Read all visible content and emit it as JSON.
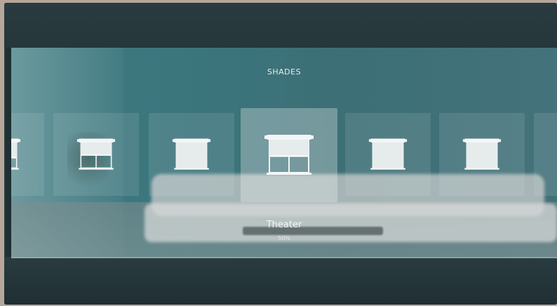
{
  "screen": {
    "title": "SHADES",
    "selected": {
      "label": "Theater",
      "level": "50%"
    }
  },
  "shades": [
    {
      "id": 1,
      "level_fraction": 0.4,
      "selected": false
    },
    {
      "id": 2,
      "level_fraction": 0.5,
      "selected": false
    },
    {
      "id": 3,
      "level_fraction": 0.0,
      "selected": false
    },
    {
      "id": 4,
      "level_fraction": 0.5,
      "selected": true
    },
    {
      "id": 5,
      "level_fraction": 0.0,
      "selected": false
    },
    {
      "id": 6,
      "level_fraction": 0.0,
      "selected": false
    },
    {
      "id": 7,
      "level_fraction": 0.4,
      "selected": false
    }
  ],
  "colors": {
    "accent": "#ffffff",
    "background": "#3f7b82"
  }
}
